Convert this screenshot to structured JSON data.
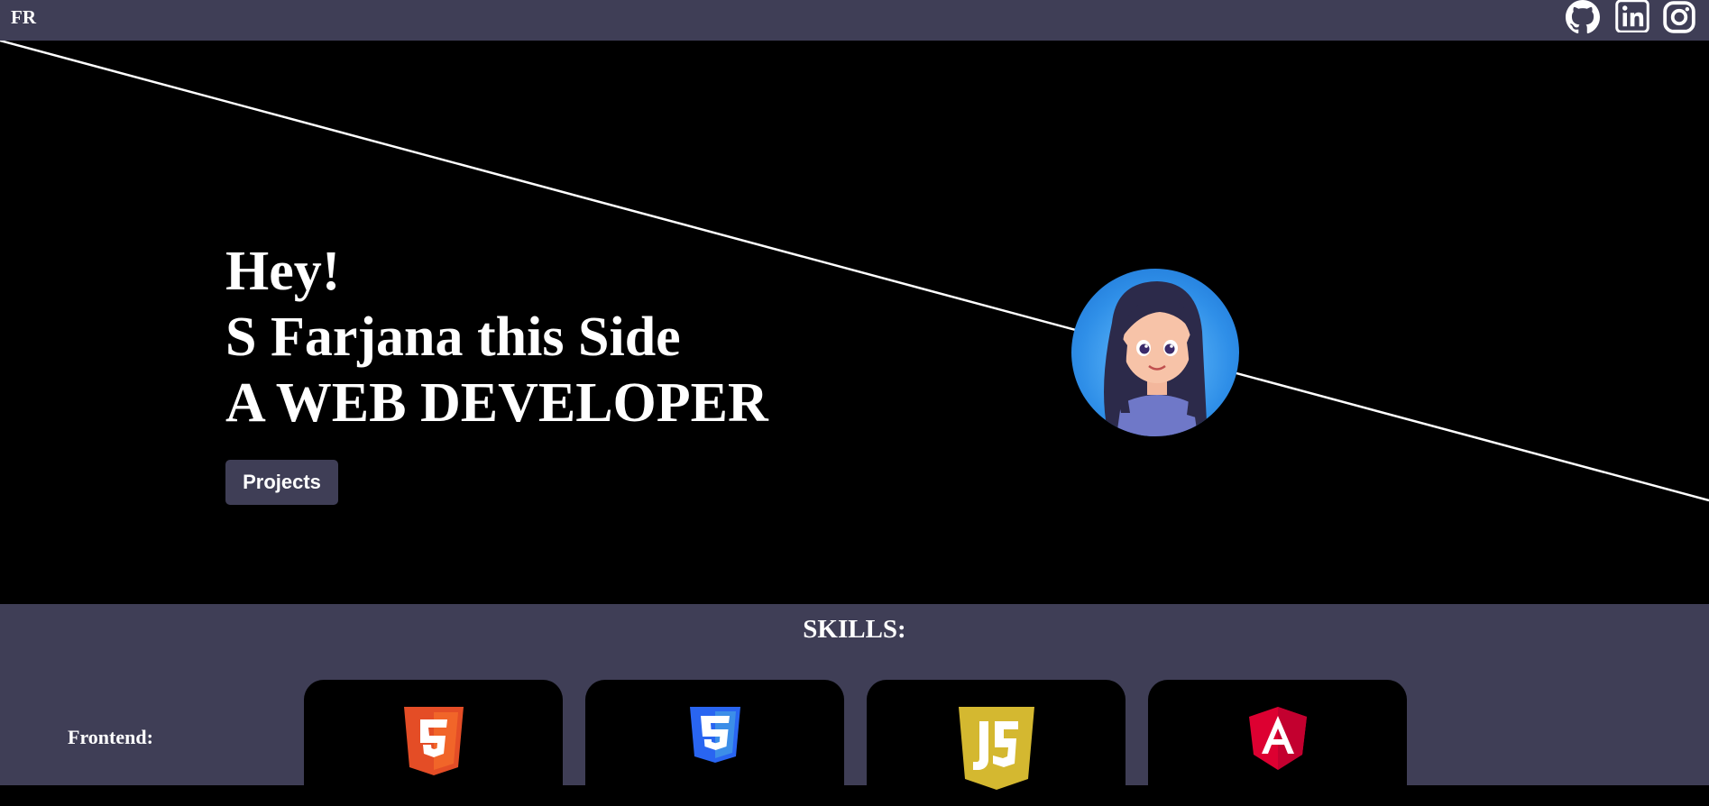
{
  "navbar": {
    "brand": "FR",
    "social": [
      {
        "name": "github-icon"
      },
      {
        "name": "linkedin-icon"
      },
      {
        "name": "instagram-icon"
      }
    ]
  },
  "hero": {
    "line1": "Hey!",
    "line2": "S Farjana this Side",
    "line3": "A WEB DEVELOPER",
    "projects_button": "Projects"
  },
  "skills": {
    "title": "SKILLS:",
    "frontend_label": "Frontend:",
    "frontend": [
      {
        "icon": "html5-icon",
        "color": "#e44d26"
      },
      {
        "icon": "css3-icon",
        "color": "#2965f1"
      },
      {
        "icon": "javascript-icon",
        "color": "#d4b830"
      },
      {
        "icon": "angular-icon",
        "color": "#dd0031"
      }
    ]
  },
  "colors": {
    "nav_bg": "#3f3e56",
    "hero_bg": "#000000",
    "text": "#ffffff"
  }
}
